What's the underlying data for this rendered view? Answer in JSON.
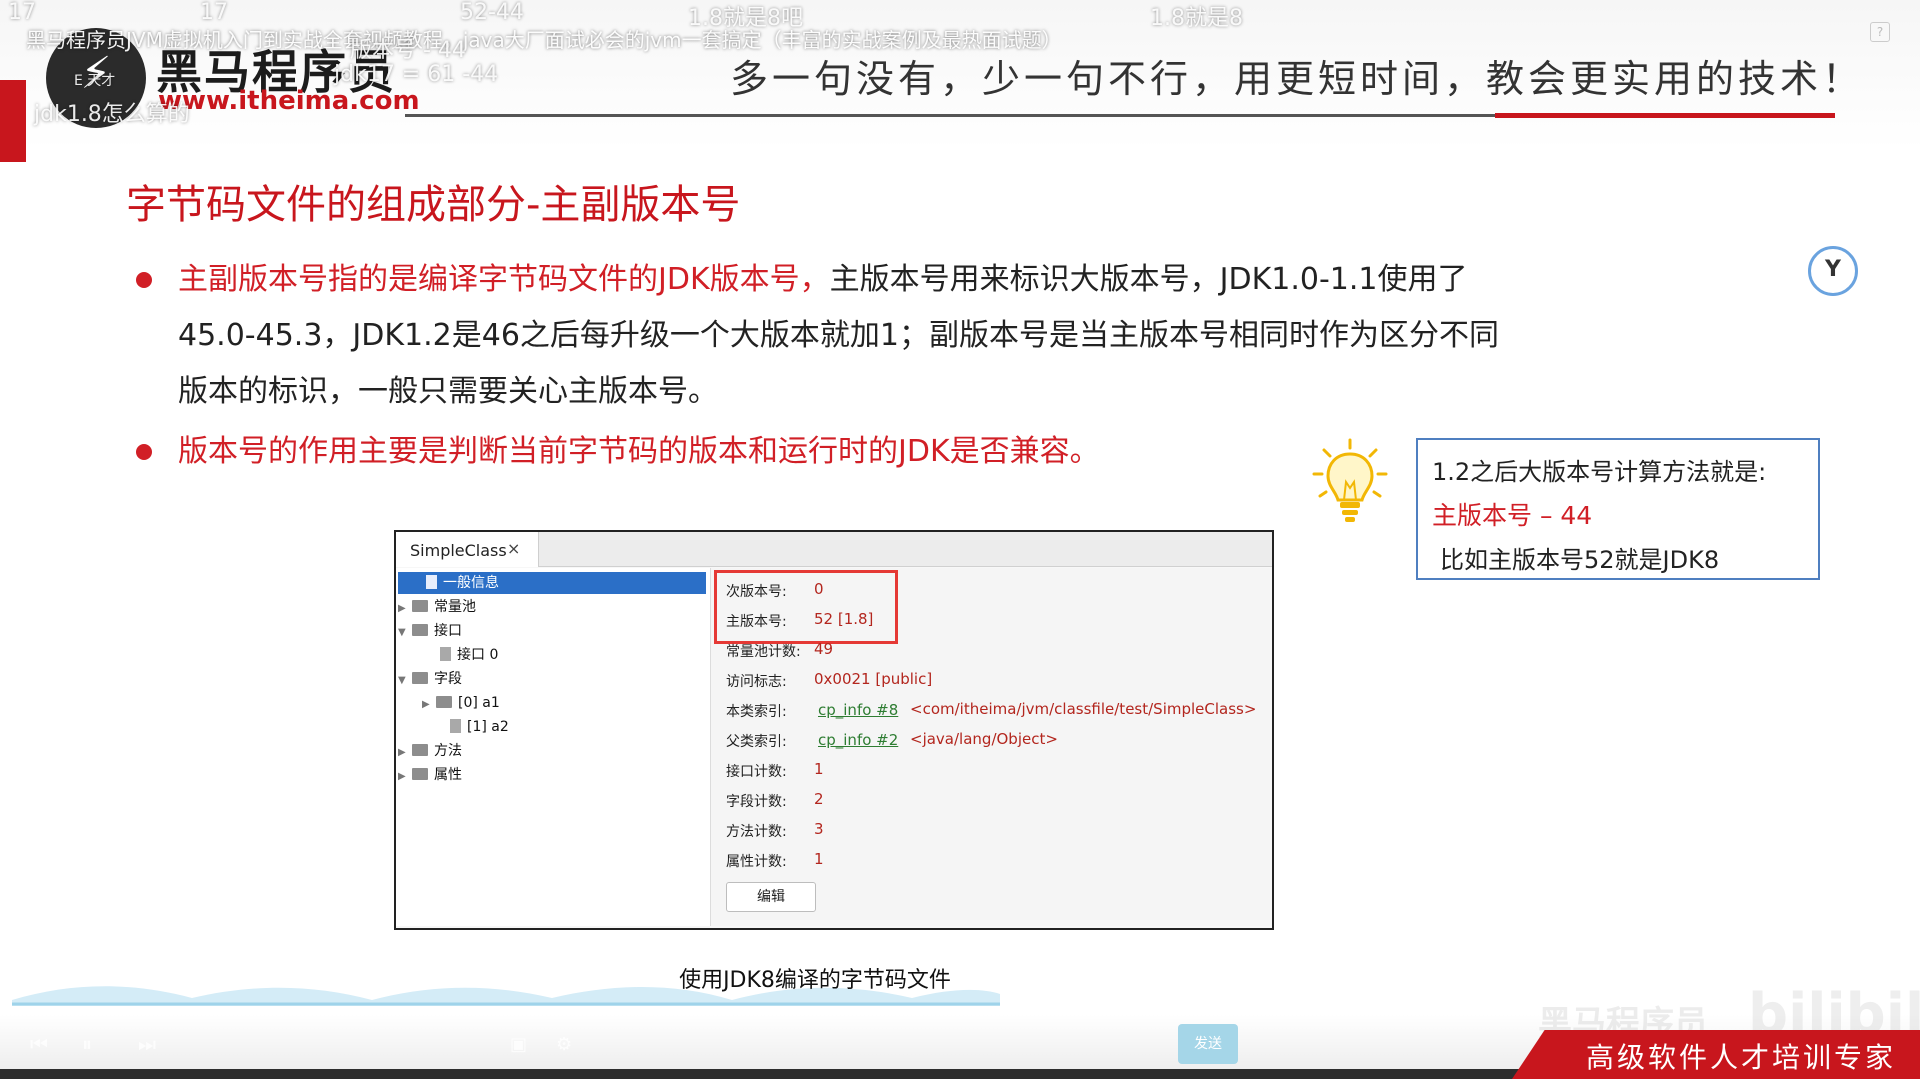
{
  "header": {
    "logo_glyph": "⚡",
    "logo_name": "黑马程序员",
    "logo_url": "www.itheima.com",
    "slogan": "多一句没有，少一句不行，用更短时间，教会更实用的技术！"
  },
  "player": {
    "title": "黑马程序员JVM虚拟机入门到实战全套视频教程，java大厂面试必会的jvm一套搞定（丰富的实战案例及最热面试题）",
    "danmaku": [
      "17",
      "17",
      "52-44",
      "1.8就是8吧",
      "1.8就是8",
      "jdk17 = 61 -44",
      "版本号 - 44",
      "jdk1.8怎么算的",
      "E 天才"
    ],
    "help_icon": "?",
    "send_label": "发送"
  },
  "slide": {
    "title": "字节码文件的组成部分-主副版本号",
    "bullet1_red": "主副版本号指的是编译字节码文件的JDK版本号，",
    "bullet1_line1_rest": "主版本号用来标识大版本号，JDK1.0-1.1使用了",
    "bullet1_line2": "45.0-45.3，JDK1.2是46之后每升级一个大版本就加1；副版本号是当主版本号相同时作为区分不同",
    "bullet1_line3": "版本的标识，一般只需要关心主版本号。",
    "bullet2": "版本号的作用主要是判断当前字节码的版本和运行时的JDK是否兼容。",
    "caption": "使用JDK8编译的字节码文件"
  },
  "tip": {
    "line1": "1.2之后大版本号计算方法就是:",
    "line2": "主版本号 – 44",
    "line3": "比如主版本号52就是JDK8"
  },
  "window": {
    "tab_label": "SimpleClass",
    "tab_close": "×",
    "tree": {
      "general": "一般信息",
      "constant_pool": "常量池",
      "interfaces": "接口",
      "interface0": "接口 0",
      "fields": "字段",
      "field0": "[0] a1",
      "field1": "[1] a2",
      "methods": "方法",
      "attributes": "属性"
    },
    "info": {
      "minor_label": "次版本号:",
      "minor_value": "0",
      "major_label": "主版本号:",
      "major_value": "52 [1.8]",
      "cp_count_label": "常量池计数:",
      "cp_count_value": "49",
      "access_label": "访问标志:",
      "access_value": "0x0021 [public]",
      "this_label": "本类索引:",
      "this_link": "cp_info #8",
      "this_value": "<com/itheima/jvm/classfile/test/SimpleClass>",
      "super_label": "父类索引:",
      "super_link": "cp_info #2",
      "super_value": "<java/lang/Object>",
      "iface_count_label": "接口计数:",
      "iface_count_value": "1",
      "field_count_label": "字段计数:",
      "field_count_value": "2",
      "method_count_label": "方法计数:",
      "method_count_value": "3",
      "attr_count_label": "属性计数:",
      "attr_count_value": "1",
      "edit_button": "编辑"
    }
  },
  "footer": {
    "slogan": "高级软件人才培训专家",
    "watermark_cn": "黑马程序员",
    "watermark_bili": "bilibili"
  }
}
